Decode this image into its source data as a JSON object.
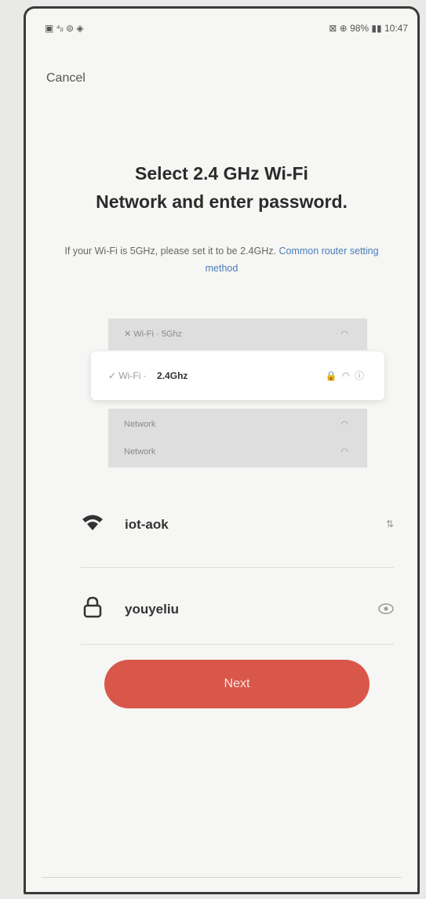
{
  "status_bar": {
    "left": "▣ ⁴ᵢₗ ⊜ ◈",
    "right": "⊠ ⊕ 98% ▮▮ 10:47"
  },
  "header": {
    "cancel_label": "Cancel"
  },
  "title": {
    "line1": "Select 2.4 GHz Wi-Fi",
    "line2": "Network and enter password."
  },
  "subtitle": {
    "text": "If your Wi-Fi is 5GHz, please set it to be 2.4GHz.",
    "link": "Common router setting method"
  },
  "illustration": {
    "row_5g": "✕  Wi-Fi · 5Ghz",
    "active_prefix": "✓  Wi-Fi ·",
    "active_band": "2.4Ghz",
    "row3": "Network",
    "row4": "Network"
  },
  "form": {
    "ssid_value": "iot-aok",
    "ssid_trail": "⇅",
    "password_value": "youyeliu"
  },
  "actions": {
    "next_label": "Next"
  }
}
